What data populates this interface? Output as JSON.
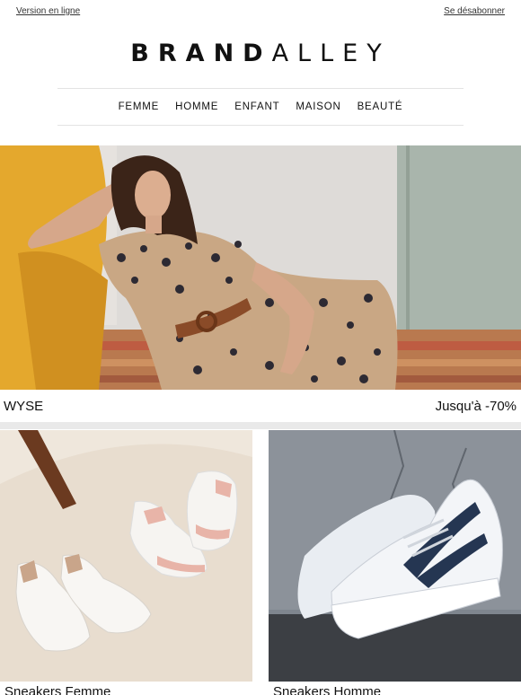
{
  "header": {
    "web_version_link": "Version en ligne",
    "unsubscribe_link": "Se désabonner"
  },
  "logo": {
    "part1": "BRAND",
    "part2": "ALLEY"
  },
  "nav": {
    "items": [
      {
        "label": "FEMME"
      },
      {
        "label": "HOMME"
      },
      {
        "label": "ENFANT"
      },
      {
        "label": "MAISON"
      },
      {
        "label": "BEAUTÉ"
      }
    ]
  },
  "hero": {
    "brand": "WYSE",
    "discount": "Jusqu'à -70%"
  },
  "tiles": [
    {
      "label": "Sneakers Femme"
    },
    {
      "label": "Sneakers Homme"
    }
  ]
}
